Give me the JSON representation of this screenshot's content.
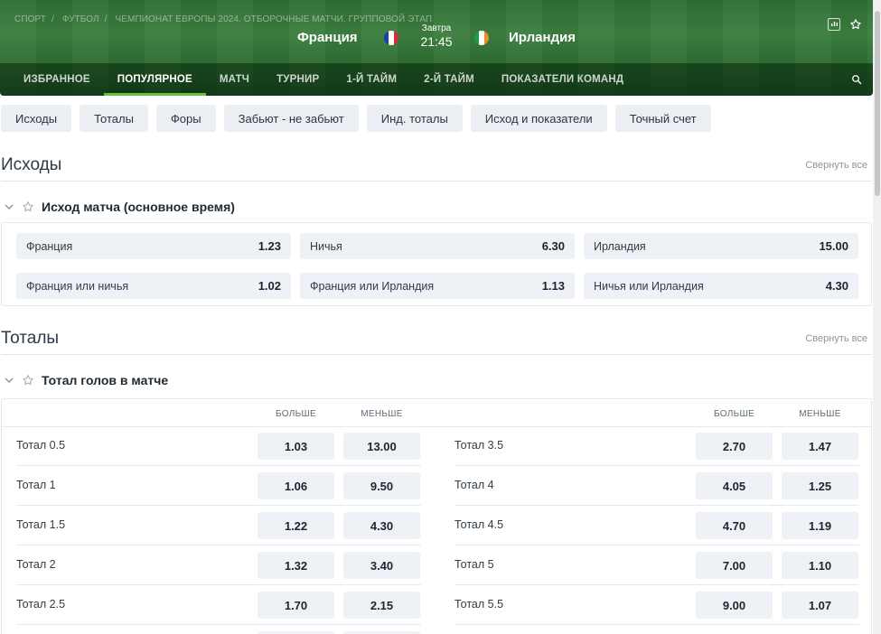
{
  "breadcrumb": [
    "СПОРТ",
    "ФУТБОЛ",
    "ЧЕМПИОНАТ ЕВРОПЫ 2024. ОТБОРОЧНЫЕ МАТЧИ. ГРУППОВОЙ ЭТАП"
  ],
  "match": {
    "home": "Франция",
    "away": "Ирландия",
    "day": "Завтра",
    "time": "21:45"
  },
  "nav": [
    {
      "label": "ИЗБРАННОЕ",
      "active": false
    },
    {
      "label": "ПОПУЛЯРНОЕ",
      "active": true
    },
    {
      "label": "МАТЧ",
      "active": false
    },
    {
      "label": "ТУРНИР",
      "active": false
    },
    {
      "label": "1-Й ТАЙМ",
      "active": false
    },
    {
      "label": "2-Й ТАЙМ",
      "active": false
    },
    {
      "label": "ПОКАЗАТЕЛИ КОМАНД",
      "active": false
    }
  ],
  "chips": [
    "Исходы",
    "Тоталы",
    "Форы",
    "Забьют - не забьют",
    "Инд. тоталы",
    "Исход и показатели",
    "Точный счет"
  ],
  "sections": {
    "outcomes": {
      "title": "Исходы",
      "collapse": "Свернуть все",
      "market": "Исход матча (основное время)",
      "cells": [
        {
          "label": "Франция",
          "odd": "1.23"
        },
        {
          "label": "Ничья",
          "odd": "6.30"
        },
        {
          "label": "Ирландия",
          "odd": "15.00"
        },
        {
          "label": "Франция или ничья",
          "odd": "1.02"
        },
        {
          "label": "Франция или Ирландия",
          "odd": "1.13"
        },
        {
          "label": "Ничья или Ирландия",
          "odd": "4.30"
        }
      ]
    },
    "totals": {
      "title": "Тоталы",
      "collapse": "Свернуть все",
      "market": "Тотал голов в матче",
      "over": "БОЛЬШЕ",
      "under": "МЕНЬШЕ",
      "left": [
        {
          "label": "Тотал 0.5",
          "over": "1.03",
          "under": "13.00"
        },
        {
          "label": "Тотал 1",
          "over": "1.06",
          "under": "9.50"
        },
        {
          "label": "Тотал 1.5",
          "over": "1.22",
          "under": "4.30"
        },
        {
          "label": "Тотал 2",
          "over": "1.32",
          "under": "3.40"
        },
        {
          "label": "Тотал 2.5",
          "over": "1.70",
          "under": "2.15"
        }
      ],
      "right": [
        {
          "label": "Тотал 3.5",
          "over": "2.70",
          "under": "1.47"
        },
        {
          "label": "Тотал 4",
          "over": "4.05",
          "under": "1.25"
        },
        {
          "label": "Тотал 4.5",
          "over": "4.70",
          "under": "1.19"
        },
        {
          "label": "Тотал 5",
          "over": "7.00",
          "under": "1.10"
        },
        {
          "label": "Тотал 5.5",
          "over": "9.00",
          "under": "1.07"
        }
      ]
    }
  },
  "colors": {
    "header_green": "#2f6e35",
    "active_underline": "#6fbf3f",
    "cell_bg": "#eef2f6",
    "chip_bg": "#ebeff3"
  },
  "icons": [
    "stats-icon",
    "star-icon",
    "search-icon",
    "chevron-down-icon"
  ]
}
